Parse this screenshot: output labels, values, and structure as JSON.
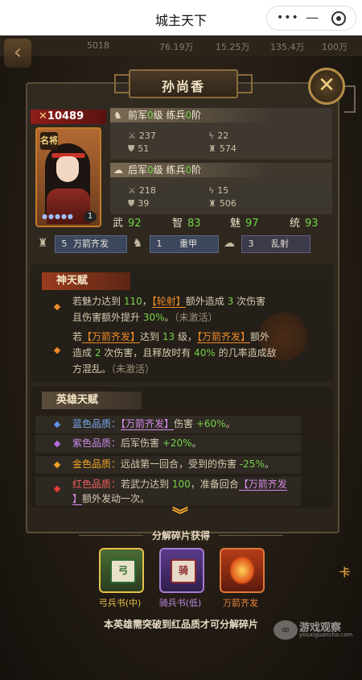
{
  "navbar": {
    "title": "城主天下",
    "more": "•••",
    "minimize": "—"
  },
  "resources": [
    "5018",
    "76.19万",
    "15.25万",
    "135.4万",
    "100万"
  ],
  "hero": {
    "name": "孙尚香",
    "power_prefix": "✕",
    "power": "10489",
    "portrait_tag": "名将",
    "stars": "●●●●●",
    "level": "1"
  },
  "armies": [
    {
      "label_a": "前军",
      "level": "0",
      "label_b": "级 练兵",
      "stage": "0",
      "label_c": "阶",
      "attack": "237",
      "speed": "22",
      "defense": "51",
      "troops": "574"
    },
    {
      "label_a": "后军",
      "level": "0",
      "label_b": "级 练兵",
      "stage": "0",
      "label_c": "阶",
      "attack": "218",
      "speed": "15",
      "defense": "39",
      "troops": "506"
    }
  ],
  "attributes": [
    {
      "key": "武",
      "value": "92"
    },
    {
      "key": "智",
      "value": "83"
    },
    {
      "key": "魅",
      "value": "97"
    },
    {
      "key": "统",
      "value": "93"
    }
  ],
  "units": [
    {
      "num": "5",
      "label": "万箭齐发",
      "icon": "helmet-icon"
    },
    {
      "num": "1",
      "label": "重甲",
      "icon": "horse-icon"
    },
    {
      "num": "3",
      "label": "乱射",
      "icon": "cloud-icon"
    }
  ],
  "divine_talent": {
    "title": "神天赋",
    "t1": {
      "p1": "若魅力达到 ",
      "v1": "110",
      "p2": "，",
      "skill": "【轮射】",
      "p3": "额外造成 ",
      "v2": "3",
      "p4": " 次伤害",
      "l2a": "且伤害额外提升 ",
      "v3": "30%",
      "l2b": "。",
      "status": "（未激活）"
    },
    "t2": {
      "p1": "若",
      "skill1": "【万箭齐发】",
      "p2": "达到 ",
      "v1": "13",
      "p3": " 级，",
      "skill2": "【万箭齐发】",
      "p4": "额外",
      "l2a": "造成 ",
      "v2": "2",
      "l2b": " 次伤害，且释放时有 ",
      "v3": "40%",
      "l2c": " 的几率造成敌",
      "l3": "方混乱。",
      "status": "（未激活）"
    }
  },
  "hero_talent": {
    "title": "英雄天赋",
    "blue": {
      "label": "蓝色品质：",
      "skill": "【万箭齐发】",
      "p1": "伤害 ",
      "v": "+60%",
      "p2": "。"
    },
    "purple": {
      "label": "紫色品质：",
      "p1": "后军伤害 ",
      "v": "+20%",
      "p2": "。"
    },
    "gold": {
      "label": "金色品质：",
      "p1": "远战第一回合，受到的伤害 ",
      "v": "-25%",
      "p2": "。"
    },
    "red": {
      "label": "红色品质：",
      "p1": "若武力达到 ",
      "v": "100",
      "p2": "，准备回合",
      "skill_a": "【万箭齐发",
      "skill_b": "】",
      "p3": "额外发动一次。"
    }
  },
  "fragments": {
    "title": "分解碎片获得",
    "items": [
      {
        "label": "弓兵书(中)",
        "glyph": "弓",
        "color": "#e8c34a"
      },
      {
        "label": "骑兵书(低)",
        "glyph": "骑",
        "color": "#b98ae0"
      },
      {
        "label": "万箭齐发",
        "glyph": "",
        "color": "#e8823a"
      }
    ],
    "note": "本英雄需突破到红品质才可分解碎片"
  },
  "side_label": "卡",
  "watermark": {
    "text": "游戏观察",
    "url": "youxiguancha.com"
  },
  "colors": {
    "green_value": "#74d34a",
    "skill_orange": "#f08a2a",
    "skill_purple": "#d48ae8",
    "accent_gold": "#f0a428"
  }
}
